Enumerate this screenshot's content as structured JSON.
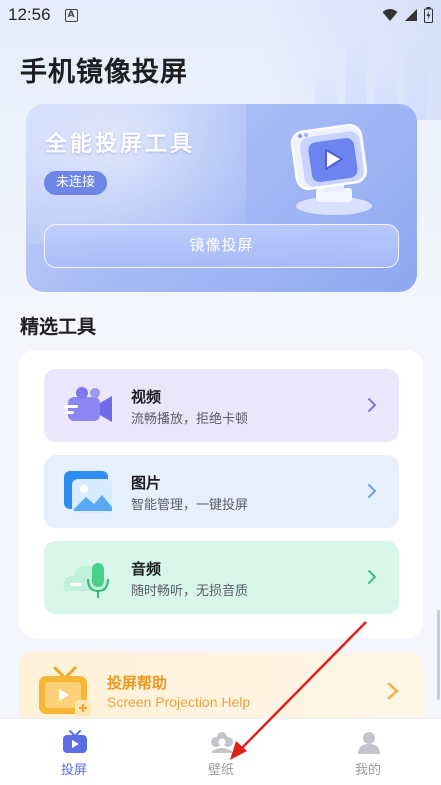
{
  "status_bar": {
    "time": "12:56",
    "notif_badge": "A"
  },
  "page": {
    "title": "手机镜像投屏"
  },
  "hero": {
    "title": "全能投屏工具",
    "badge": "未连接",
    "button_label": "镜像投屏"
  },
  "tools_section": {
    "title": "精选工具",
    "items": [
      {
        "name": "视频",
        "desc": "流畅播放，拒绝卡顿",
        "bg": "#eae7fb"
      },
      {
        "name": "图片",
        "desc": "智能管理，一键投屏",
        "bg": "#e6effd"
      },
      {
        "name": "音频",
        "desc": "随时畅听，无损音质",
        "bg": "#d8f6ea"
      }
    ]
  },
  "help": {
    "title": "投屏帮助",
    "subtitle": "Screen Projection Help"
  },
  "tabbar": {
    "tabs": [
      {
        "label": "投屏",
        "active": true
      },
      {
        "label": "壁纸",
        "active": false
      },
      {
        "label": "我的",
        "active": false
      }
    ]
  },
  "colors": {
    "accent": "#5b6ee8",
    "inactive": "#9a9ca3",
    "help_orange": "#e99a1c",
    "annotation_red": "#e0201d"
  }
}
